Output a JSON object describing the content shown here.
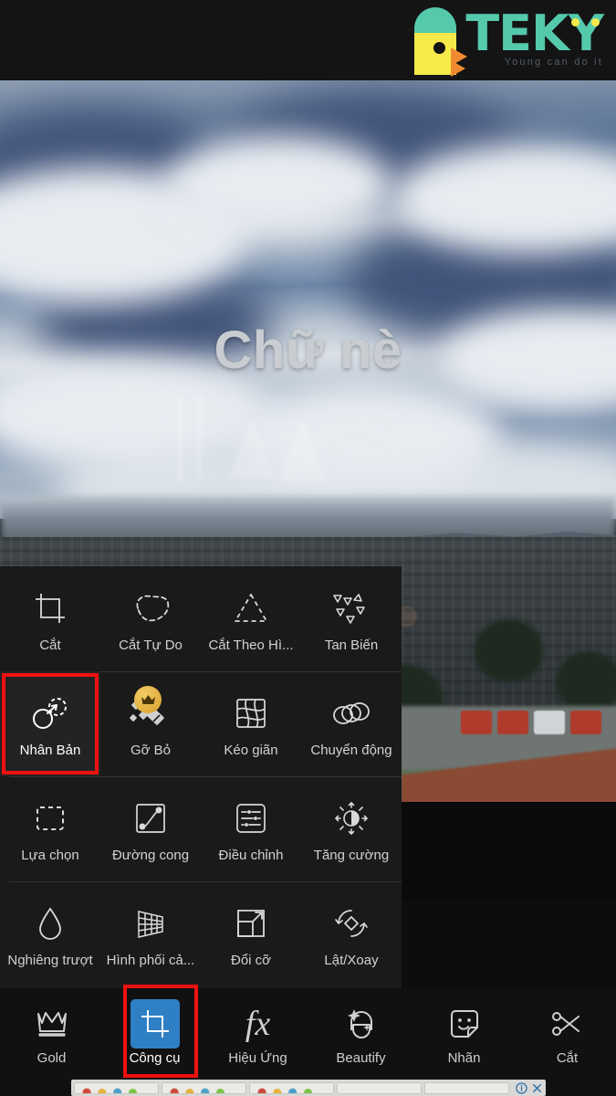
{
  "header": {
    "logo_name": "TEKY",
    "logo_tagline": "Young can do it",
    "brand_teal": "#55c9ac",
    "brand_yellow": "#f6ea4a",
    "brand_orange": "#f08a30",
    "logo_icon": "teky-bird-logo"
  },
  "canvas": {
    "overlay_text": "Chữ nè",
    "overlay_text_color": "#c9cdd1"
  },
  "tools_panel": {
    "highlight_color": "#ee1111",
    "rows": [
      {
        "items": [
          {
            "label": "Cắt",
            "icon": "crop-icon",
            "selected": false,
            "premium": false
          },
          {
            "label": "Cắt Tự Do",
            "icon": "freeform-crop-icon",
            "selected": false,
            "premium": false
          },
          {
            "label": "Cắt Theo Hì...",
            "icon": "shape-crop-icon",
            "selected": false,
            "premium": false
          },
          {
            "label": "Tan Biến",
            "icon": "dispersion-icon",
            "selected": false,
            "premium": false
          }
        ]
      },
      {
        "items": [
          {
            "label": "Nhân Bản",
            "icon": "clone-stamp-icon",
            "selected": true,
            "premium": false
          },
          {
            "label": "Gỡ Bỏ",
            "icon": "remove-eraser-icon",
            "selected": false,
            "premium": true
          },
          {
            "label": "Kéo giãn",
            "icon": "stretch-grid-icon",
            "selected": false,
            "premium": false
          },
          {
            "label": "Chuyển động",
            "icon": "motion-icon",
            "selected": false,
            "premium": false
          }
        ]
      },
      {
        "items": [
          {
            "label": "Lựa chọn",
            "icon": "selection-marquee-icon",
            "selected": false,
            "premium": false
          },
          {
            "label": "Đường cong",
            "icon": "curves-icon",
            "selected": false,
            "premium": false
          },
          {
            "label": "Điều chỉnh",
            "icon": "adjust-sliders-icon",
            "selected": false,
            "premium": false
          },
          {
            "label": "Tăng cường",
            "icon": "enhance-brightness-icon",
            "selected": false,
            "premium": false
          }
        ]
      },
      {
        "items": [
          {
            "label": "Nghiêng trượt",
            "icon": "tilt-shift-drop-icon",
            "selected": false,
            "premium": false
          },
          {
            "label": "Hình phối cả...",
            "icon": "perspective-grid-icon",
            "selected": false,
            "premium": false
          },
          {
            "label": "Đổi cỡ",
            "icon": "resize-icon",
            "selected": false,
            "premium": false
          },
          {
            "label": "Lật/Xoay",
            "icon": "flip-rotate-icon",
            "selected": false,
            "premium": false
          }
        ]
      }
    ]
  },
  "bottom_nav": {
    "active_color": "#2f7fc4",
    "highlight_color": "#ee1111",
    "items": [
      {
        "label": "Gold",
        "icon": "crown-icon",
        "active": false
      },
      {
        "label": "Công cụ",
        "icon": "tools-crop-icon",
        "active": true
      },
      {
        "label": "Hiệu Ứng",
        "icon": "fx-icon",
        "active": false
      },
      {
        "label": "Beautify",
        "icon": "beautify-face-icon",
        "active": false
      },
      {
        "label": "Nhãn",
        "icon": "sticker-icon",
        "active": false
      },
      {
        "label": "Cắt",
        "icon": "cut-icon",
        "active": false
      }
    ]
  },
  "ad_banner": {
    "info_icon": "info-icon",
    "close_icon": "close-icon"
  }
}
